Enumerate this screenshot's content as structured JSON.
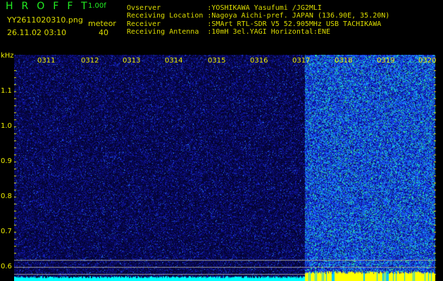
{
  "header": {
    "title": "HROFFT",
    "version": "1.00f",
    "filename": "YY2611020310.png",
    "timestamp": "26.11.02 03:10",
    "meteor_label": "meteor",
    "meteor_count": "40"
  },
  "info": [
    "Ovserver           :YOSHIKAWA Yasufumi /JG2MLI",
    "Receiving Location :Nagoya Aichi-pref. JAPAN (136.90E, 35.20N)",
    "Receiver           :SMArt RTL-SDR V5 52.905MHz USB TACHIKAWA",
    "Receiving Antenna  :10mH 3el.YAGI Horizontal:ENE"
  ],
  "y_axis": {
    "unit": "kHz",
    "ticks": [
      "1.1",
      "1.0",
      "0.9",
      "0.8",
      "0.7",
      "0.6"
    ]
  },
  "x_axis": {
    "ticks": [
      "0311",
      "0312",
      "0313",
      "0314",
      "0315",
      "0316",
      "0317",
      "0318",
      "0319",
      "0320"
    ]
  },
  "colors": {
    "text": "#dddd00",
    "title": "#22ee22",
    "level_low": "#00ffff",
    "level_high": "#ffff00"
  }
}
